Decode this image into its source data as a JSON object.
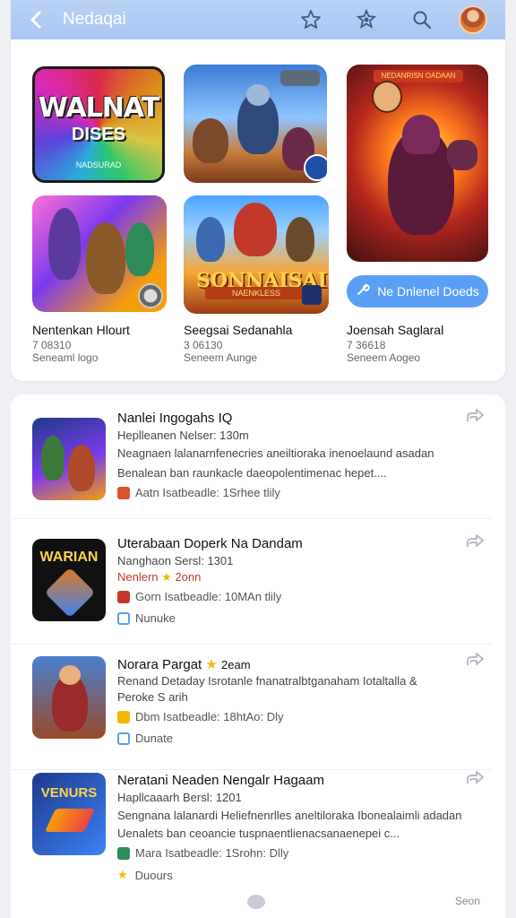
{
  "header": {
    "title": "Nedaqai"
  },
  "featured": {
    "tile1": {
      "title": "WALNAT",
      "subtitle": "DISES",
      "tiny": "NADSURAD"
    },
    "tile3": {
      "banner": "NEDANRISN OADAAN"
    },
    "tile5": {
      "title": "SONNAISAI",
      "subtitle": "NAENKLESS"
    },
    "cta_label": "Ne Dnlenel Doeds",
    "games": [
      {
        "name": "Nentenkan Hlourt",
        "id": "7 08310",
        "meta": "Seneaml logo"
      },
      {
        "name": "Seegsai Sedanahla",
        "id": "3 06130",
        "meta": "Seneem Aunge"
      },
      {
        "name": "Joensah Saglaral",
        "id": "7 36618",
        "meta": "Seneem Aogeo"
      }
    ]
  },
  "list": {
    "items": [
      {
        "name": "Nanlei Ingogahs IQ",
        "sub": "Heplleanen Nelser: 130m",
        "desc1": "Neagnaen lalanarnfenecries aneiltioraka inenoelaund asadan",
        "desc2": "Benalean ban raunkacle daeopolentimenac hepet....",
        "meta1": "Aatn Isatbeadle: 1Srhee tlily"
      },
      {
        "name": "Uterabaan Doperk Na Dandam",
        "sub": "Nanghaon Sersl: 1301",
        "red": "Nenlern",
        "red_star_val": "2onn",
        "meta1": "Gorn Isatbeadle: 10MAn tlily",
        "meta2": "Nunuke"
      },
      {
        "name": "Norara Pargat",
        "name_star_val": "2eam",
        "sub": "Renand Detaday Isrotanle fnanatralbtganaham Iotaltalla &",
        "sub2": "Peroke S arih",
        "meta1": "Dbm Isatbeadle: 18htAo: Dly",
        "meta2": "Dunate"
      },
      {
        "name": "Neratani Neaden Nengalr Hagaam",
        "sub": "Hapllcaaarh Bersl: 1201",
        "desc1": "Sengnana lalanardi Heliefnenrlles aneltiloraka Ibonealaimli adadan",
        "desc2": "Uenalets ban ceoancie tuspnaentlienacsanaenepei c...",
        "meta1": "Mara Isatbeadle: 1Srohn: Dlly",
        "meta2": "Duours"
      }
    ]
  },
  "footer": {
    "right_text": "Seon"
  },
  "colors": {
    "topbar": "#a9c6f2",
    "accent": "#5b9ef5",
    "star": "#f2b705"
  }
}
